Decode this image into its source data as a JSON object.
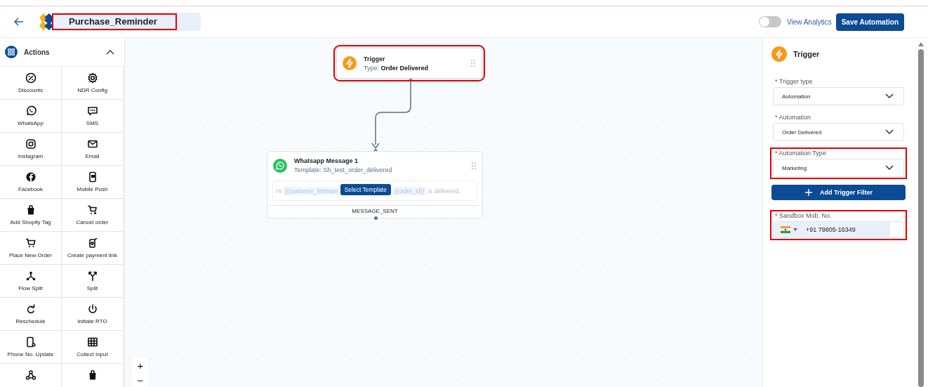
{
  "header": {
    "title": "Purchase_Reminder",
    "title_highlighted": true,
    "analytics_toggle": {
      "label": "View Analytics",
      "on": false
    },
    "save_button": "Save Automation"
  },
  "sidebar": {
    "title": "Actions",
    "expanded": true,
    "items": [
      {
        "label": "Discounts"
      },
      {
        "label": "NDR Config"
      },
      {
        "label": "WhatsApp"
      },
      {
        "label": "SMS"
      },
      {
        "label": "Instagram"
      },
      {
        "label": "Email"
      },
      {
        "label": "Facebook"
      },
      {
        "label": "Mobile Push"
      },
      {
        "label": "Add Shopify Tag"
      },
      {
        "label": "Cancel order"
      },
      {
        "label": "Place New Order"
      },
      {
        "label": "Create payment link"
      },
      {
        "label": "Flow Split"
      },
      {
        "label": "Split"
      },
      {
        "label": "Reschedule"
      },
      {
        "label": "Initiate RTO"
      },
      {
        "label": "Phone No. Update"
      },
      {
        "label": "Collect Input"
      }
    ]
  },
  "canvas": {
    "zoom_in": "+",
    "zoom_out": "−",
    "trigger_node": {
      "title": "Trigger",
      "type_label": "Type:",
      "type_value": "Order Delivered",
      "highlighted": true
    },
    "message_node": {
      "title": "Whatsapp Message 1",
      "subtitle": "Template: Sh_test_order_delivered",
      "select_button": "Select Template",
      "footer": "MESSAGE_SENT",
      "preview": [
        {
          "kind": "text",
          "text": "Hi"
        },
        {
          "kind": "variable",
          "text": "{{customer_firstnam"
        },
        {
          "kind": "button"
        },
        {
          "kind": "variable",
          "text": "{{order_id}}"
        },
        {
          "kind": "text",
          "text": "is"
        },
        {
          "kind": "text",
          "text": "delivered."
        }
      ]
    }
  },
  "panel": {
    "title": "Trigger",
    "fields": [
      {
        "label": "* Trigger type",
        "value": "Automation",
        "highlighted": false
      },
      {
        "label": "* Automation",
        "value": "Order Delivered",
        "highlighted": false
      },
      {
        "label": "* Automation Type",
        "value": "Marketing",
        "highlighted": true
      }
    ],
    "add_filter_button": "Add Trigger Filter",
    "phone": {
      "label": "* Sandbox Mob. No.",
      "value": "+91 79805-16349",
      "highlighted": true
    }
  }
}
